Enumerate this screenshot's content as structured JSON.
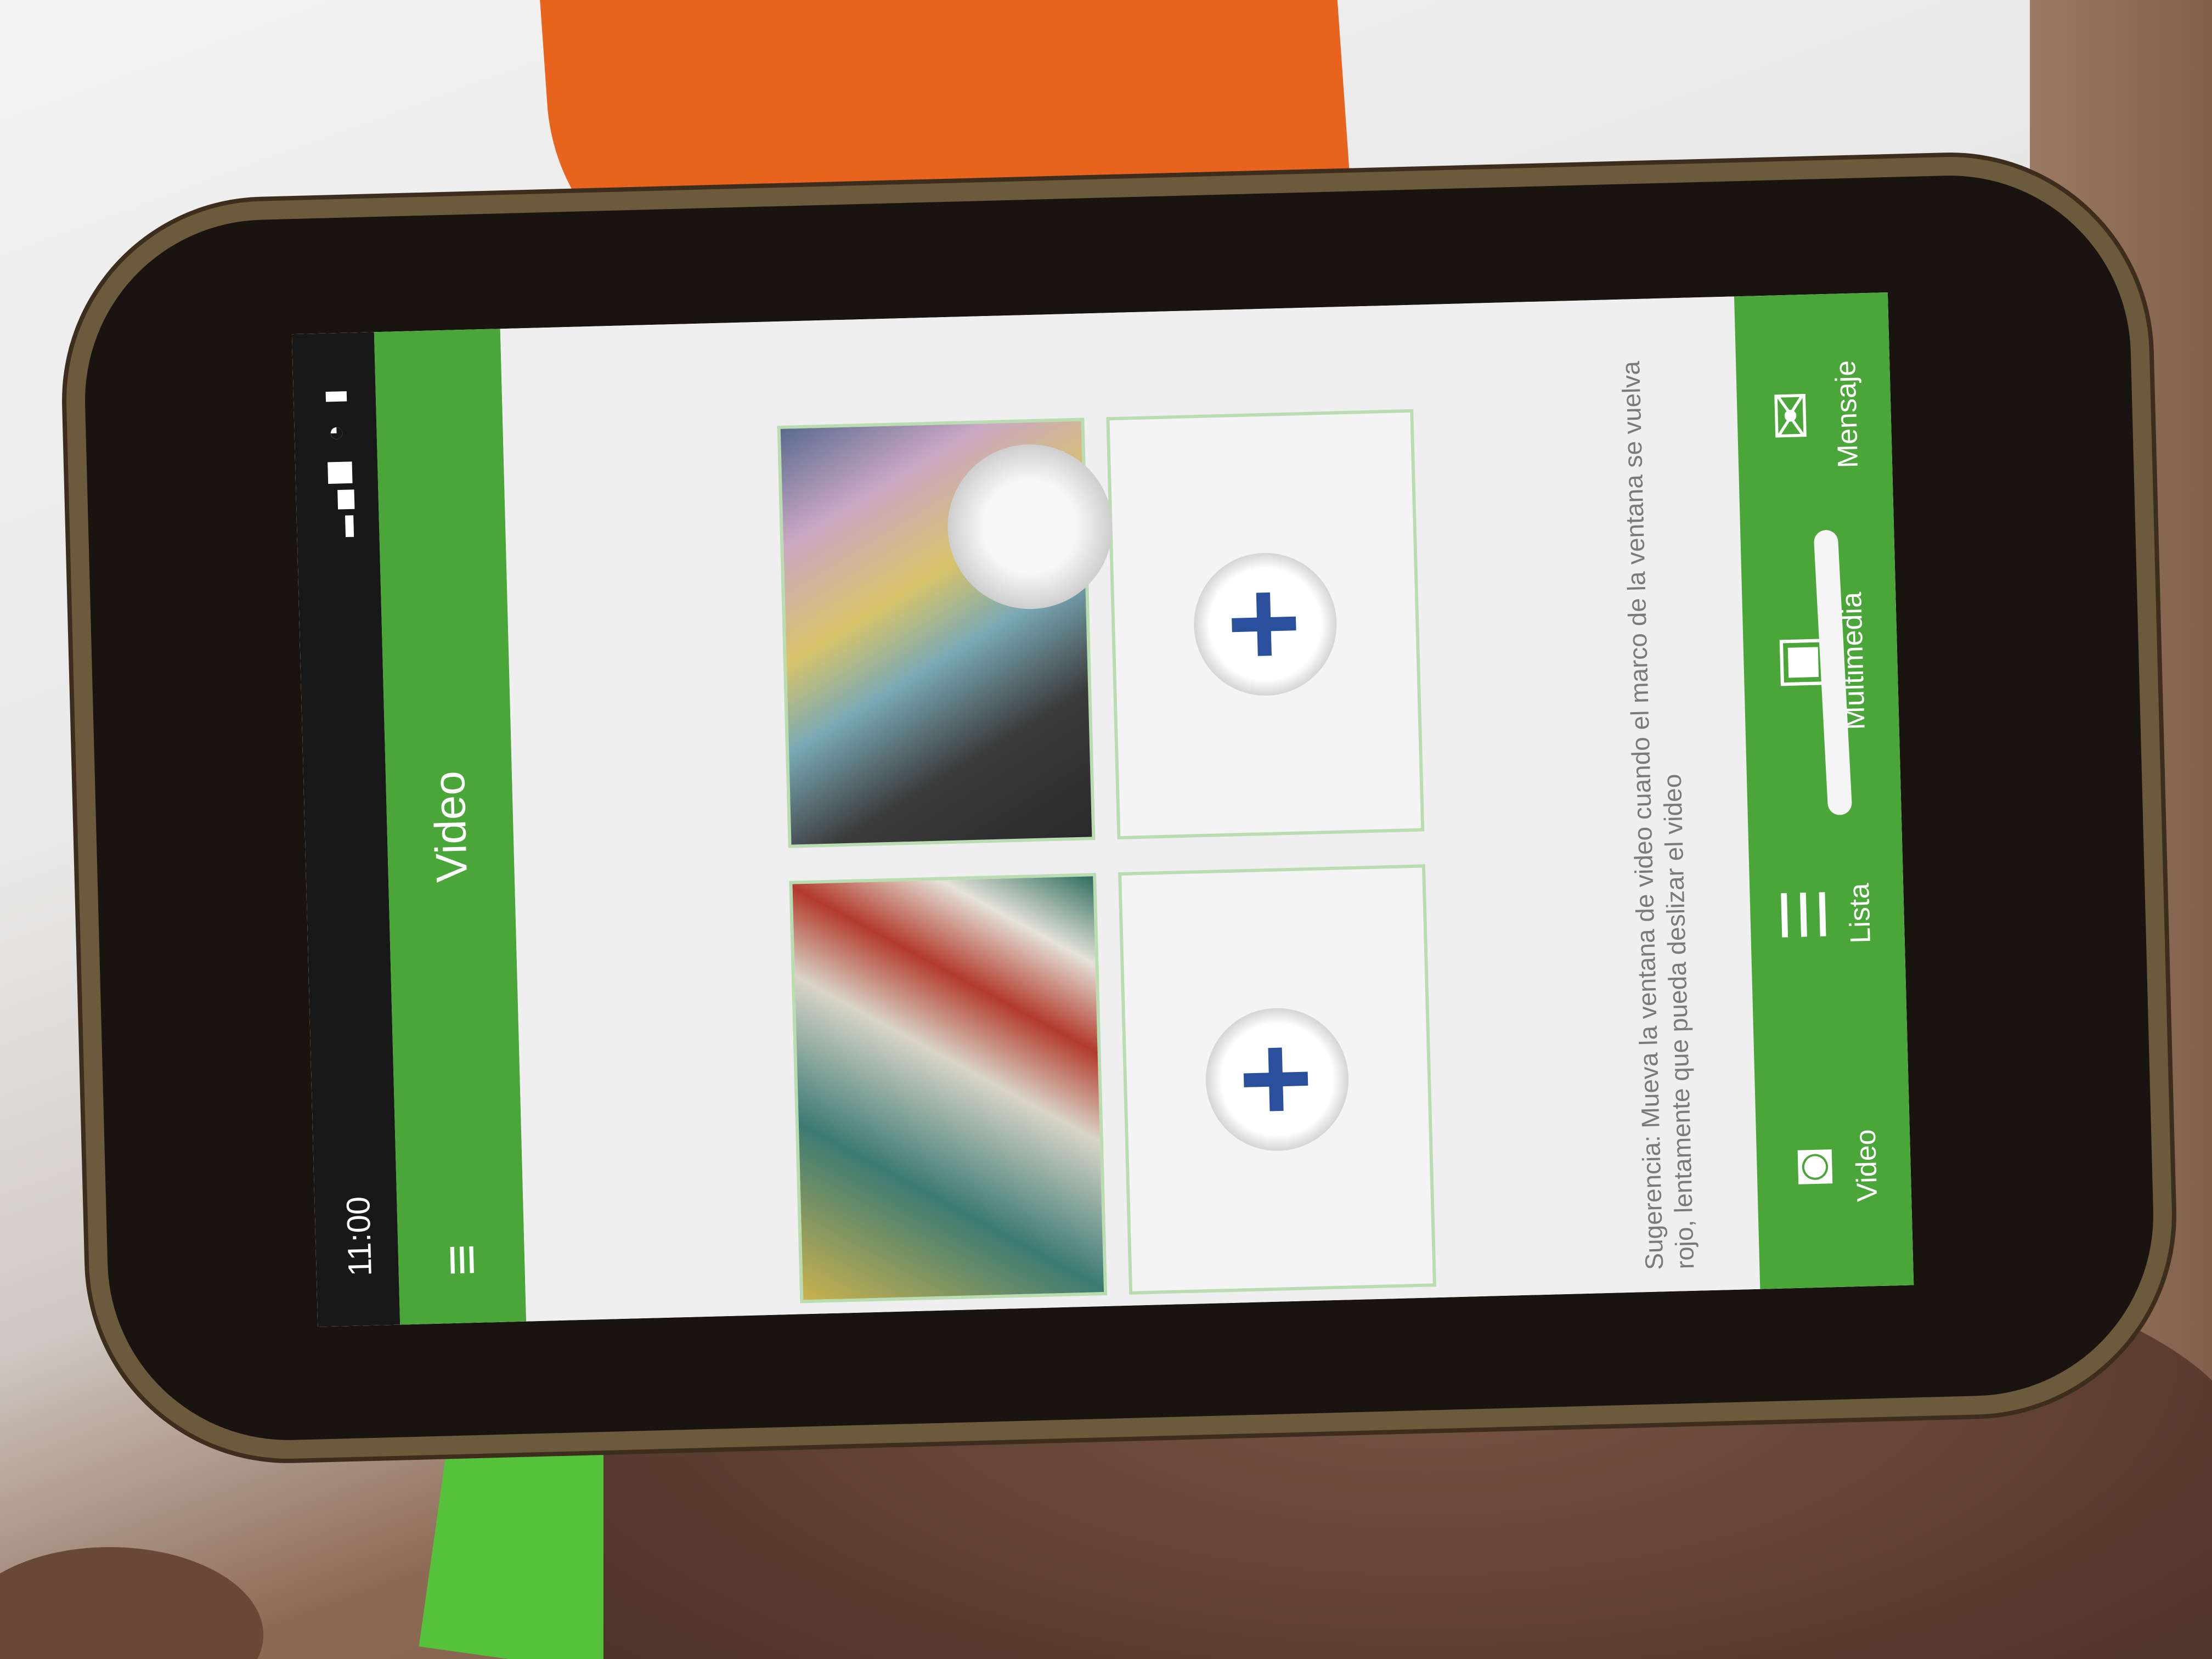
{
  "status_bar": {
    "time": "11:00",
    "icons": "▂▄▆ ◔ ▮"
  },
  "header": {
    "title": "Video",
    "menu_icon": "menu-icon"
  },
  "grid": {
    "cells": [
      {
        "type": "video",
        "label": "camera-feed-1"
      },
      {
        "type": "video",
        "label": "camera-feed-2"
      },
      {
        "type": "add",
        "symbol": "+"
      },
      {
        "type": "add",
        "symbol": "+"
      }
    ]
  },
  "hint_text": "Sugerencia: Mueva la ventana de video cuando el marco de la ventana se vuelva rojo, lentamente que pueda deslizar el video",
  "tabs": [
    {
      "label": "Video",
      "icon": "camera-icon",
      "glyph": "◙"
    },
    {
      "label": "Lista",
      "icon": "list-icon",
      "glyph": "☰"
    },
    {
      "label": "Multimedia",
      "icon": "folder-icon",
      "glyph": "▣"
    },
    {
      "label": "Mensaje",
      "icon": "chat-icon",
      "glyph": "✉"
    }
  ],
  "colors": {
    "accent": "#4ba63a",
    "plus": "#2a4f9c"
  }
}
